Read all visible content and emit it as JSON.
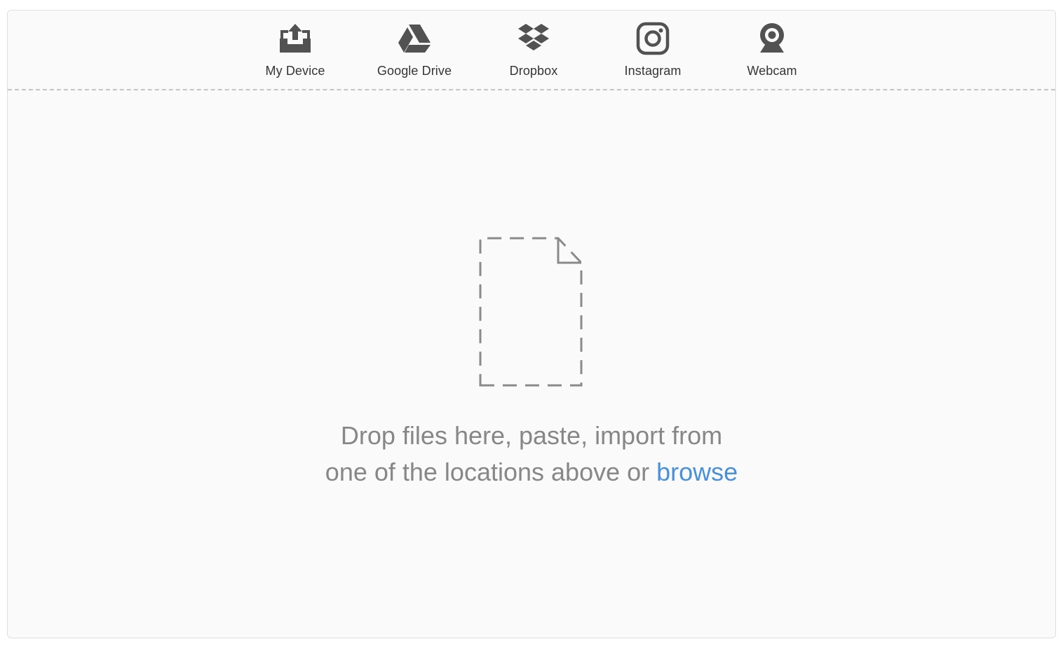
{
  "sources": [
    {
      "label": "My Device",
      "icon": "upload-tray-icon"
    },
    {
      "label": "Google Drive",
      "icon": "google-drive-icon"
    },
    {
      "label": "Dropbox",
      "icon": "dropbox-icon"
    },
    {
      "label": "Instagram",
      "icon": "instagram-icon"
    },
    {
      "label": "Webcam",
      "icon": "webcam-icon"
    }
  ],
  "drop_zone": {
    "line1": "Drop files here, paste, import from",
    "line2": "one of the locations above or",
    "browse_label": "browse",
    "icon": "dashed-file-icon"
  },
  "colors": {
    "background": "#fafafa",
    "icon": "#525252",
    "label_text": "#353535",
    "note_text": "#878787",
    "link": "#4a90d9",
    "divider": "#c4c4c4"
  }
}
